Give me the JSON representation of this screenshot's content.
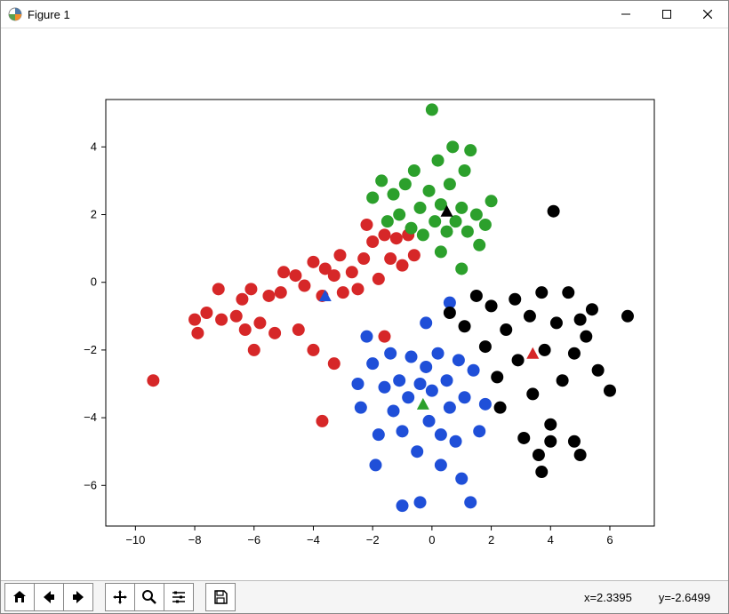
{
  "window": {
    "title": "Figure 1"
  },
  "winbtns": {
    "min": "–",
    "max": "☐",
    "close": "✕"
  },
  "toolbar": {
    "home": "Home",
    "back": "Back",
    "forward": "Forward",
    "pan": "Pan",
    "zoom": "Zoom",
    "configure": "Configure subplots",
    "save": "Save"
  },
  "status": {
    "x_label": "x=",
    "x_val": "2.3395",
    "y_label": "y=",
    "y_val": "-2.6499"
  },
  "chart_data": {
    "type": "scatter",
    "title": "",
    "xlabel": "",
    "ylabel": "",
    "xlim": [
      -11,
      7.5
    ],
    "ylim": [
      -7.2,
      5.4
    ],
    "xticks": [
      -10,
      -8,
      -6,
      -4,
      -2,
      0,
      2,
      4,
      6
    ],
    "yticks": [
      -6,
      -4,
      -2,
      0,
      2,
      4
    ],
    "series": [
      {
        "name": "cluster-red",
        "color": "#d62728",
        "marker": "o",
        "points": [
          [
            -9.4,
            -2.9
          ],
          [
            -8.0,
            -1.1
          ],
          [
            -7.9,
            -1.5
          ],
          [
            -7.6,
            -0.9
          ],
          [
            -7.2,
            -0.2
          ],
          [
            -7.1,
            -1.1
          ],
          [
            -6.6,
            -1.0
          ],
          [
            -6.4,
            -0.5
          ],
          [
            -6.3,
            -1.4
          ],
          [
            -6.1,
            -0.2
          ],
          [
            -6.0,
            -2.0
          ],
          [
            -5.8,
            -1.2
          ],
          [
            -5.5,
            -0.4
          ],
          [
            -5.3,
            -1.5
          ],
          [
            -5.1,
            -0.3
          ],
          [
            -5.0,
            0.3
          ],
          [
            -4.6,
            0.2
          ],
          [
            -4.5,
            -1.4
          ],
          [
            -4.3,
            -0.1
          ],
          [
            -4.0,
            -2.0
          ],
          [
            -4.0,
            0.6
          ],
          [
            -3.7,
            -0.4
          ],
          [
            -3.6,
            0.4
          ],
          [
            -3.3,
            0.2
          ],
          [
            -3.1,
            0.8
          ],
          [
            -3.0,
            -0.3
          ],
          [
            -3.3,
            -2.4
          ],
          [
            -2.7,
            0.3
          ],
          [
            -2.5,
            -0.2
          ],
          [
            -2.3,
            0.7
          ],
          [
            -2.2,
            1.7
          ],
          [
            -2.0,
            1.2
          ],
          [
            -1.8,
            0.1
          ],
          [
            -1.6,
            1.4
          ],
          [
            -1.4,
            0.7
          ],
          [
            -1.2,
            1.3
          ],
          [
            -1.0,
            0.5
          ],
          [
            -0.8,
            1.4
          ],
          [
            -0.6,
            0.8
          ],
          [
            -1.6,
            -1.6
          ],
          [
            -3.7,
            -4.1
          ]
        ]
      },
      {
        "name": "cluster-green",
        "color": "#2ca02c",
        "marker": "o",
        "points": [
          [
            -2.0,
            2.5
          ],
          [
            -1.7,
            3.0
          ],
          [
            -1.5,
            1.8
          ],
          [
            -1.3,
            2.6
          ],
          [
            -1.1,
            2.0
          ],
          [
            -0.9,
            2.9
          ],
          [
            -0.7,
            1.6
          ],
          [
            -0.6,
            3.3
          ],
          [
            -0.4,
            2.2
          ],
          [
            -0.3,
            1.4
          ],
          [
            -0.1,
            2.7
          ],
          [
            0.0,
            5.1
          ],
          [
            0.1,
            1.8
          ],
          [
            0.2,
            3.6
          ],
          [
            0.3,
            2.3
          ],
          [
            0.5,
            1.5
          ],
          [
            0.6,
            2.9
          ],
          [
            0.7,
            4.0
          ],
          [
            0.8,
            1.8
          ],
          [
            1.0,
            2.2
          ],
          [
            1.1,
            3.3
          ],
          [
            1.2,
            1.5
          ],
          [
            1.3,
            3.9
          ],
          [
            1.5,
            2.0
          ],
          [
            1.6,
            1.1
          ],
          [
            1.8,
            1.7
          ],
          [
            2.0,
            2.4
          ],
          [
            1.0,
            0.4
          ],
          [
            0.3,
            0.9
          ]
        ]
      },
      {
        "name": "cluster-blue",
        "color": "#1f4fd8",
        "marker": "o",
        "points": [
          [
            -2.2,
            -1.6
          ],
          [
            -2.5,
            -3.0
          ],
          [
            -2.4,
            -3.7
          ],
          [
            -2.0,
            -2.4
          ],
          [
            -1.8,
            -4.5
          ],
          [
            -1.9,
            -5.4
          ],
          [
            -1.6,
            -3.1
          ],
          [
            -1.4,
            -2.1
          ],
          [
            -1.3,
            -3.8
          ],
          [
            -1.1,
            -2.9
          ],
          [
            -1.0,
            -4.4
          ],
          [
            -1.0,
            -6.6
          ],
          [
            -0.8,
            -3.4
          ],
          [
            -0.7,
            -2.2
          ],
          [
            -0.5,
            -5.0
          ],
          [
            -0.4,
            -3.0
          ],
          [
            -0.4,
            -6.5
          ],
          [
            -0.2,
            -2.5
          ],
          [
            -0.1,
            -4.1
          ],
          [
            0.0,
            -3.2
          ],
          [
            0.2,
            -2.1
          ],
          [
            0.3,
            -5.4
          ],
          [
            0.3,
            -4.5
          ],
          [
            0.5,
            -2.9
          ],
          [
            0.6,
            -3.7
          ],
          [
            0.8,
            -4.7
          ],
          [
            0.9,
            -2.3
          ],
          [
            1.0,
            -5.8
          ],
          [
            1.1,
            -3.4
          ],
          [
            1.3,
            -6.5
          ],
          [
            1.4,
            -2.6
          ],
          [
            1.6,
            -4.4
          ],
          [
            1.8,
            -3.6
          ],
          [
            -0.2,
            -1.2
          ],
          [
            0.6,
            -0.6
          ]
        ]
      },
      {
        "name": "cluster-black",
        "color": "#000000",
        "marker": "o",
        "points": [
          [
            0.6,
            -0.9
          ],
          [
            1.1,
            -1.3
          ],
          [
            1.5,
            -0.4
          ],
          [
            1.8,
            -1.9
          ],
          [
            2.0,
            -0.7
          ],
          [
            2.2,
            -2.8
          ],
          [
            2.3,
            -3.7
          ],
          [
            2.5,
            -1.4
          ],
          [
            2.8,
            -0.5
          ],
          [
            2.9,
            -2.3
          ],
          [
            3.1,
            -4.6
          ],
          [
            3.3,
            -1.0
          ],
          [
            3.4,
            -3.3
          ],
          [
            3.6,
            -5.1
          ],
          [
            3.7,
            -0.3
          ],
          [
            3.7,
            -5.6
          ],
          [
            3.8,
            -2.0
          ],
          [
            4.0,
            -4.2
          ],
          [
            4.0,
            -4.7
          ],
          [
            4.1,
            2.1
          ],
          [
            4.2,
            -1.2
          ],
          [
            4.4,
            -2.9
          ],
          [
            4.6,
            -0.3
          ],
          [
            4.8,
            -4.7
          ],
          [
            4.8,
            -2.1
          ],
          [
            5.0,
            -1.1
          ],
          [
            5.0,
            -5.1
          ],
          [
            5.2,
            -1.6
          ],
          [
            5.4,
            -0.8
          ],
          [
            5.6,
            -2.6
          ],
          [
            6.0,
            -3.2
          ],
          [
            6.6,
            -1.0
          ]
        ]
      },
      {
        "name": "centroid-blue",
        "color": "#1f4fd8",
        "marker": "^",
        "points": [
          [
            -3.6,
            -0.4
          ]
        ]
      },
      {
        "name": "centroid-black",
        "color": "#000000",
        "marker": "^",
        "points": [
          [
            0.5,
            2.1
          ]
        ]
      },
      {
        "name": "centroid-green",
        "color": "#2ca02c",
        "marker": "^",
        "points": [
          [
            -0.3,
            -3.6
          ]
        ]
      },
      {
        "name": "centroid-red",
        "color": "#d62728",
        "marker": "^",
        "points": [
          [
            3.4,
            -2.1
          ]
        ]
      }
    ]
  }
}
